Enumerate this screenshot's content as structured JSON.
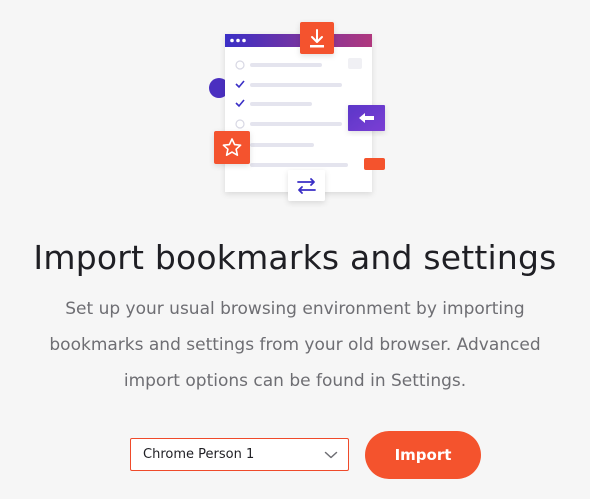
{
  "title": "Import bookmarks and settings",
  "description": "Set up your usual browsing environment by importing bookmarks and settings from your old browser. Advanced import options can be found in Settings.",
  "browser_select": {
    "selected": "Chrome Person 1"
  },
  "import_button": {
    "label": "Import"
  },
  "colors": {
    "accent": "#f4532d",
    "purple": "#4a2fc0",
    "background": "#f6f6f6"
  },
  "icons": {
    "download": "download-icon",
    "star": "star-icon",
    "arrow": "arrow-left-icon",
    "swap": "swap-arrows-icon",
    "chevron": "chevron-down-icon"
  }
}
